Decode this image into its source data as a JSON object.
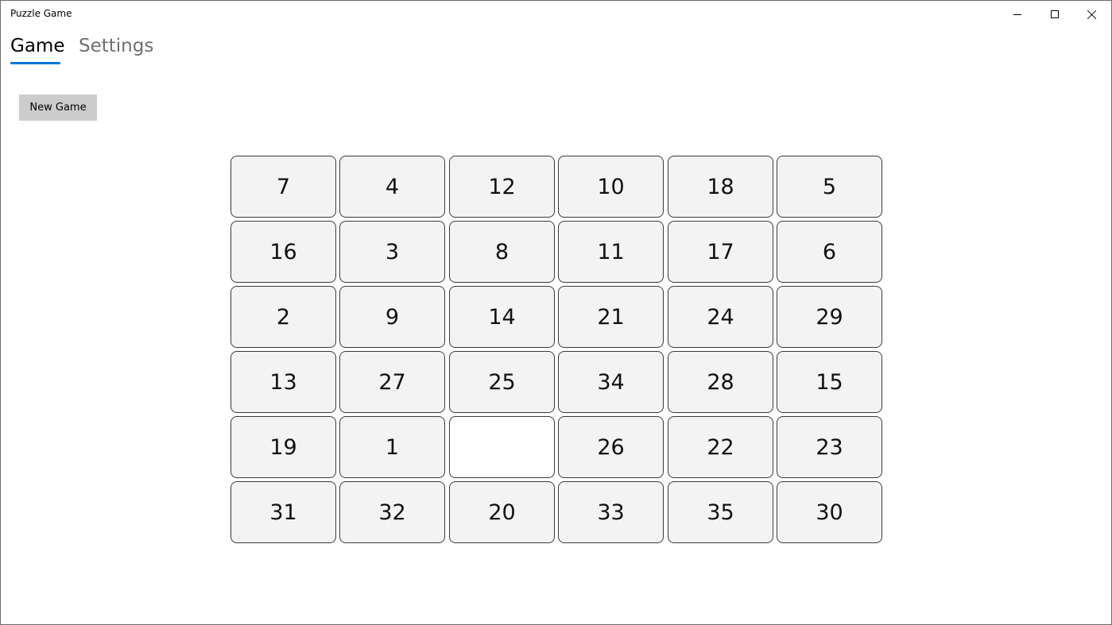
{
  "window": {
    "title": "Puzzle Game"
  },
  "tabs": [
    {
      "label": "Game",
      "selected": true
    },
    {
      "label": "Settings",
      "selected": false
    }
  ],
  "accent_color": "#0078d4",
  "new_game_label": "New Game",
  "board": {
    "rows": 6,
    "cols": 6,
    "tiles": [
      "7",
      "4",
      "12",
      "10",
      "18",
      "5",
      "16",
      "3",
      "8",
      "11",
      "17",
      "6",
      "2",
      "9",
      "14",
      "21",
      "24",
      "29",
      "13",
      "27",
      "25",
      "34",
      "28",
      "15",
      "19",
      "1",
      "",
      "26",
      "22",
      "23",
      "31",
      "32",
      "20",
      "33",
      "35",
      "30"
    ]
  }
}
